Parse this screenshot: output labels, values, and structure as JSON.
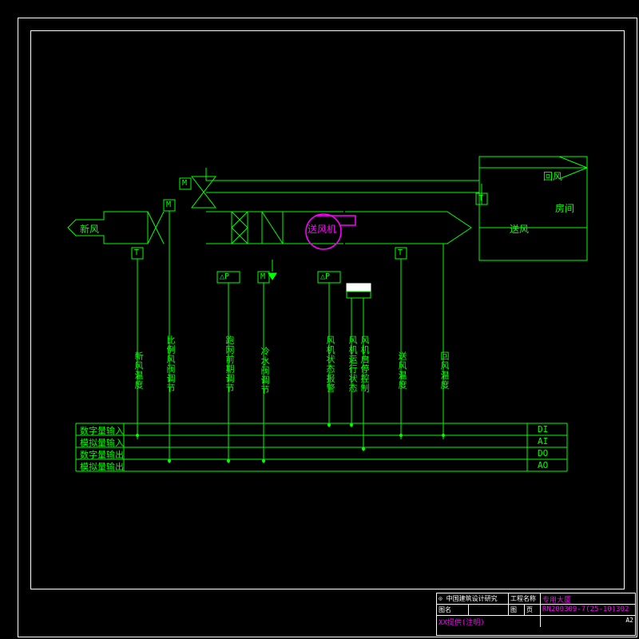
{
  "title_block": {
    "company": "中国建筑设计研究",
    "field1_label": "工程名称",
    "field1_value": "专用大厦",
    "field2_label": "图名",
    "field3_label": "图",
    "sheet_label": "页",
    "doc_no_label": "RN200309-7(25-10)302",
    "row3_left": "XX提供(注明)",
    "row3_right": "A2"
  },
  "labels": {
    "fresh_air": "新风",
    "return_air": "回风",
    "supply_air": "送风",
    "room": "房间",
    "fan": "送风机"
  },
  "vertical_labels": [
    "新风温度",
    "比例风阀调节",
    "table_gap",
    "跑网前期调节",
    "冷水阀调节",
    "table_gap",
    "风机状态报警",
    "风机运行状态",
    "风机启停控制",
    "送风温度",
    "回风温度"
  ],
  "color_labels": {
    "l1": "新风温度",
    "l2": "比例风阀调节",
    "l3": "跑网前期调节",
    "l4": "冷水阀调节",
    "l5": "风机状态报警",
    "l6": "风机运行状态",
    "l7": "风机启停控制",
    "l8": "送风温度",
    "l9": "回风温度"
  },
  "io_rows": {
    "r1_left": "数字量输入",
    "r1_right": "DI",
    "r2_left": "模拟量输入",
    "r2_right": "AI",
    "r3_left": "数字量输出",
    "r3_right": "DO",
    "r4_left": "模拟量输出",
    "r4_right": "AO"
  },
  "symbols": {
    "T": "T",
    "M": "M",
    "dP": "△P"
  }
}
